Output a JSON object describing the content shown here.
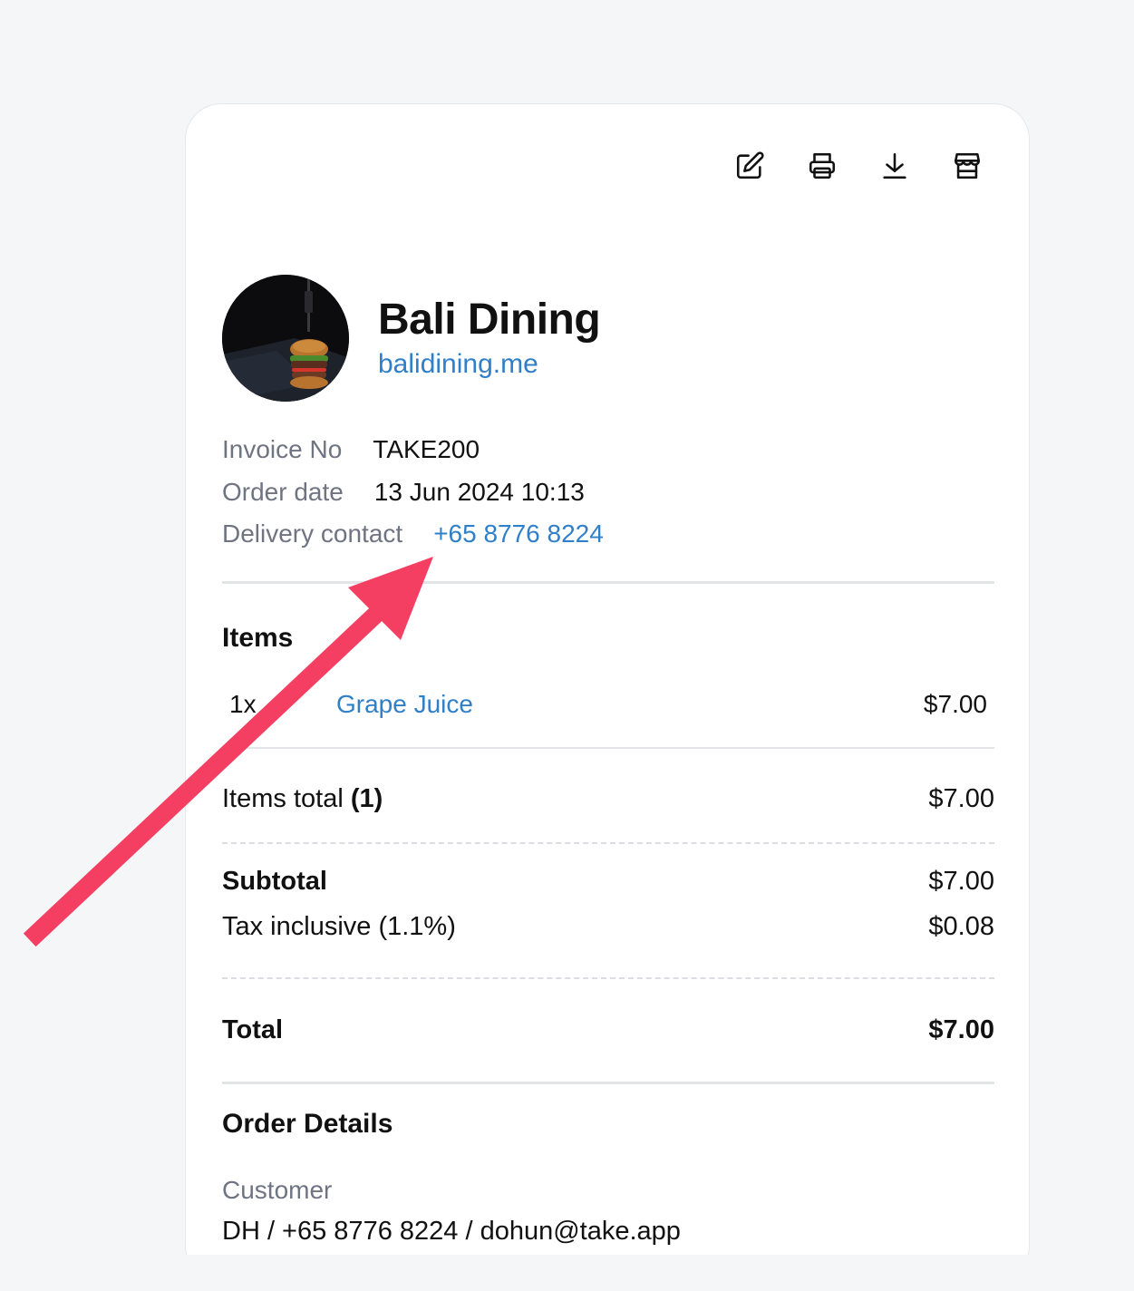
{
  "toolbar": {
    "edit_icon": "edit-icon",
    "print_icon": "printer-icon",
    "download_icon": "download-icon",
    "store_icon": "store-icon"
  },
  "store": {
    "name": "Bali Dining",
    "url": "balidining.me"
  },
  "invoice": {
    "invoice_no_label": "Invoice No",
    "invoice_no": "TAKE200",
    "order_date_label": "Order date",
    "order_date": "13 Jun 2024 10:13",
    "delivery_contact_label": "Delivery contact",
    "delivery_contact": "+65 8776 8224"
  },
  "items": {
    "title": "Items",
    "list": [
      {
        "qty": "1x",
        "name": "Grape Juice",
        "price": "$7.00"
      }
    ]
  },
  "totals": {
    "items_total_label": "Items total",
    "items_total_count": "(1)",
    "items_total": "$7.00",
    "subtotal_label": "Subtotal",
    "subtotal": "$7.00",
    "tax_label": "Tax inclusive (1.1%)",
    "tax": "$0.08",
    "total_label": "Total",
    "total": "$7.00"
  },
  "order_details": {
    "title": "Order Details",
    "customer_label": "Customer",
    "customer": "DH / +65 8776 8224 / dohun@take.app"
  },
  "colors": {
    "accent": "#2f80c8",
    "arrow": "#f43f62",
    "muted": "#6e7482"
  }
}
